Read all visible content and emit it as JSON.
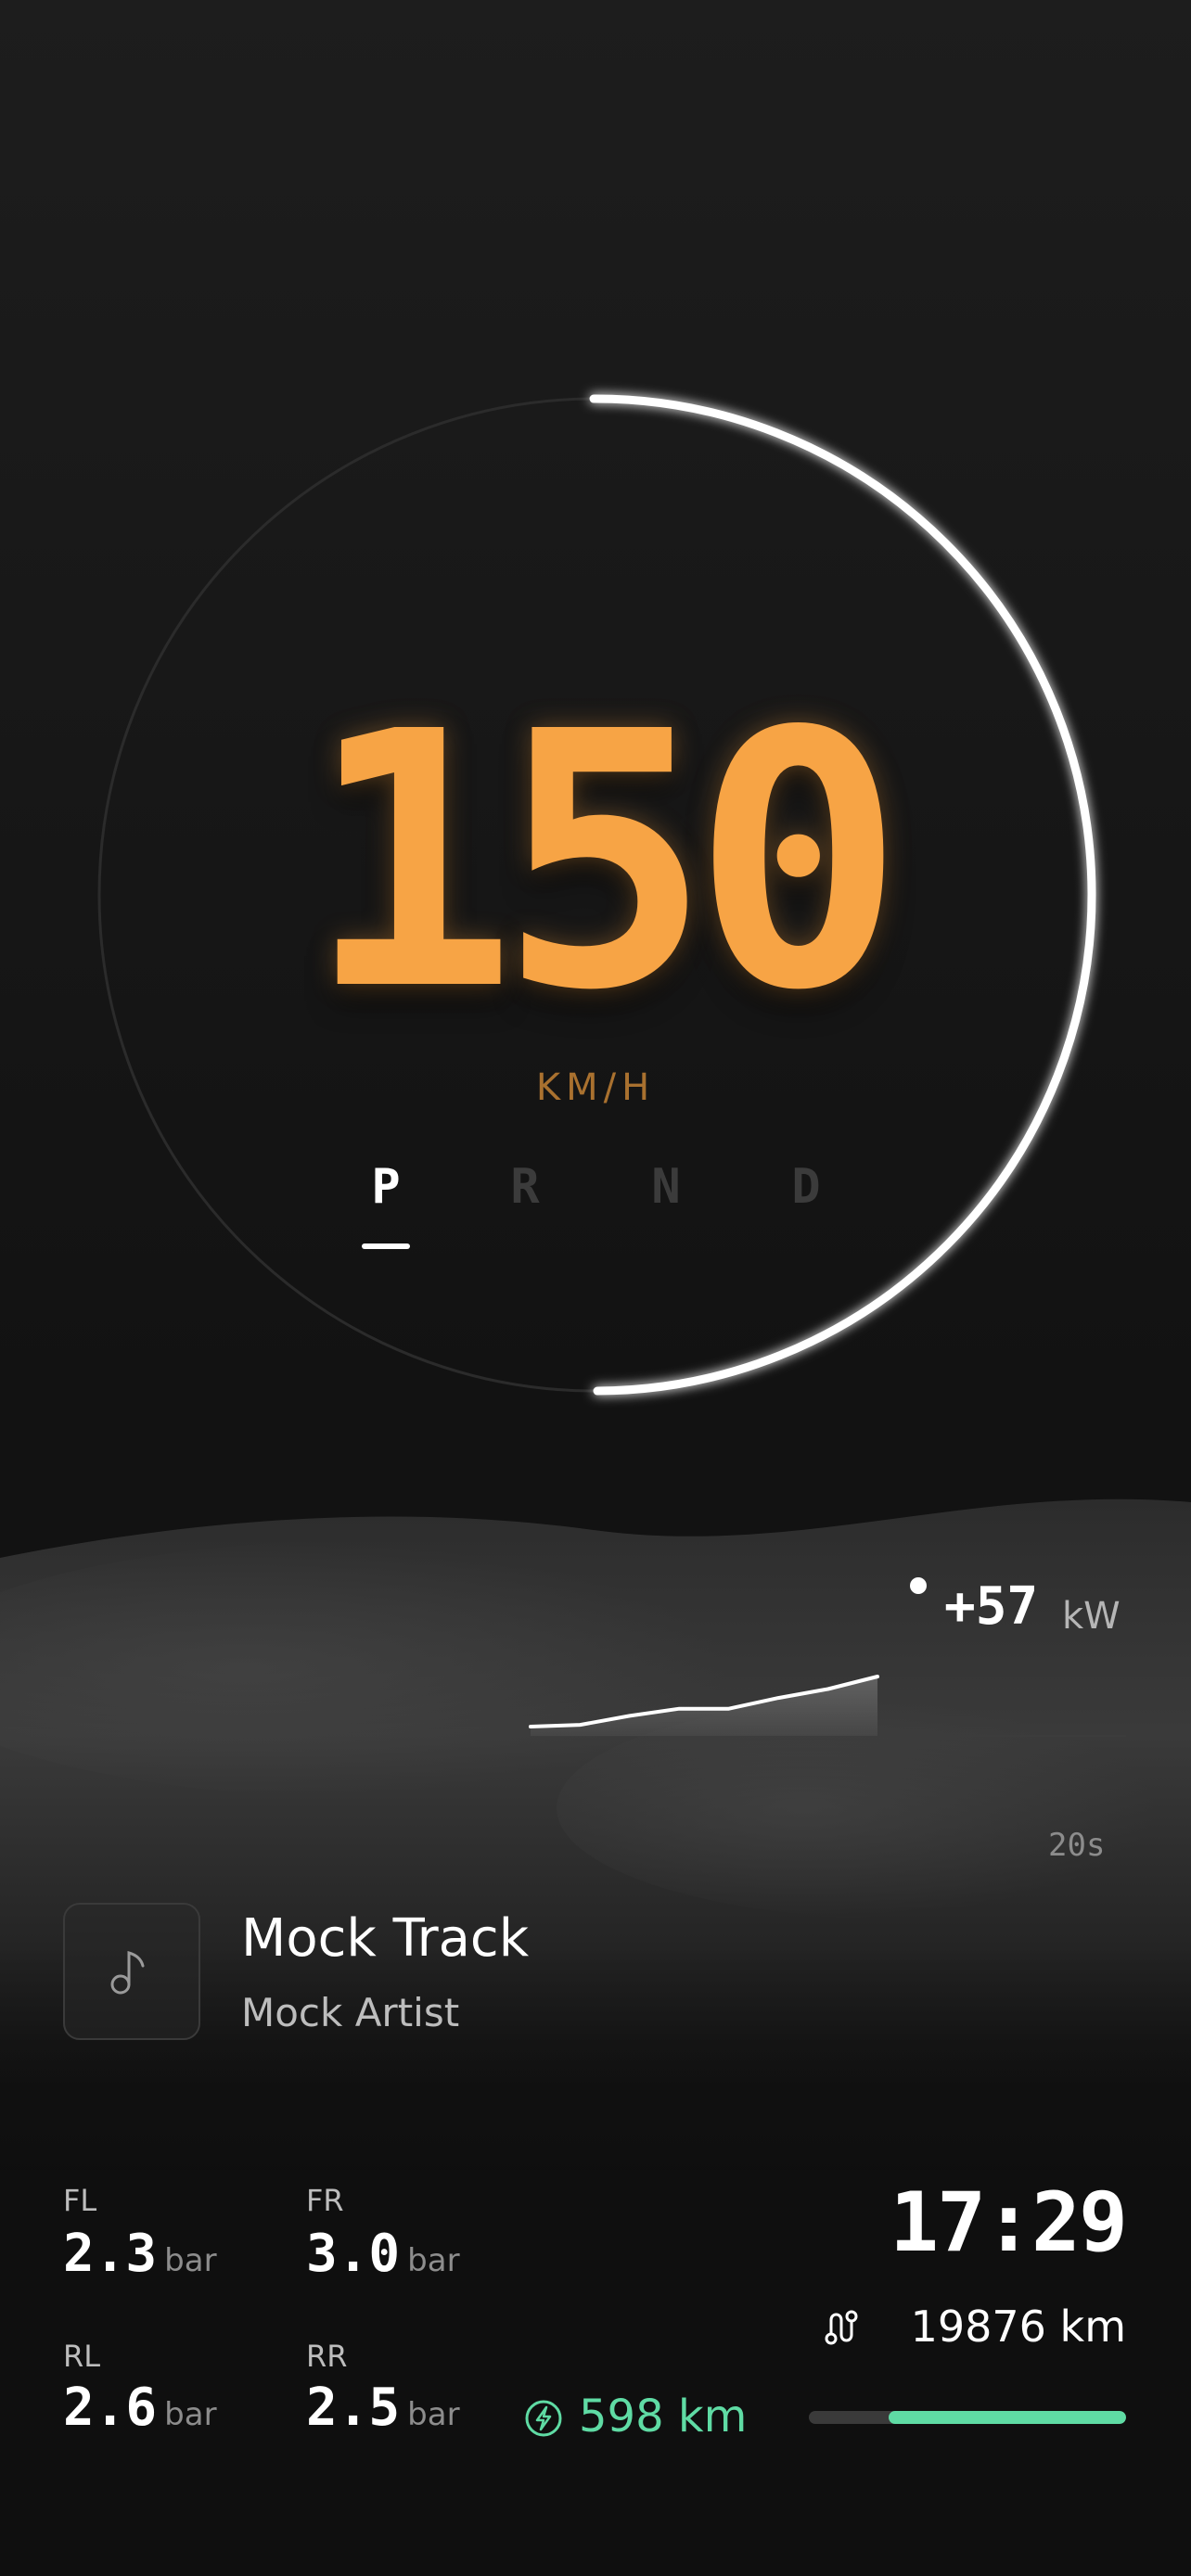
{
  "speedometer": {
    "speed": "150",
    "unit": "KM/H",
    "gears": [
      "P",
      "R",
      "N",
      "D"
    ],
    "active_gear": "P"
  },
  "power": {
    "value": "+57",
    "unit": "kW",
    "window": "20s",
    "history_kw": [
      2,
      3,
      8,
      12,
      12,
      18,
      23,
      30
    ]
  },
  "media": {
    "icon": "music-note-icon",
    "title": "Mock Track",
    "artist": "Mock Artist"
  },
  "tires": {
    "fl": {
      "label": "FL",
      "value": "2.3",
      "unit": "bar"
    },
    "fr": {
      "label": "FR",
      "value": "3.0",
      "unit": "bar"
    },
    "rl": {
      "label": "RL",
      "value": "2.6",
      "unit": "bar"
    },
    "rr": {
      "label": "RR",
      "value": "2.5",
      "unit": "bar"
    }
  },
  "clock": "17:29",
  "odometer": {
    "icon": "route-icon",
    "text": "19876 km"
  },
  "range": {
    "icon": "charge-icon",
    "text": "598 km",
    "fraction": 0.75
  },
  "colors": {
    "speed": "#f7a445",
    "unit": "#a9712f",
    "range_accent": "#5fdba4",
    "background": "#141414"
  }
}
